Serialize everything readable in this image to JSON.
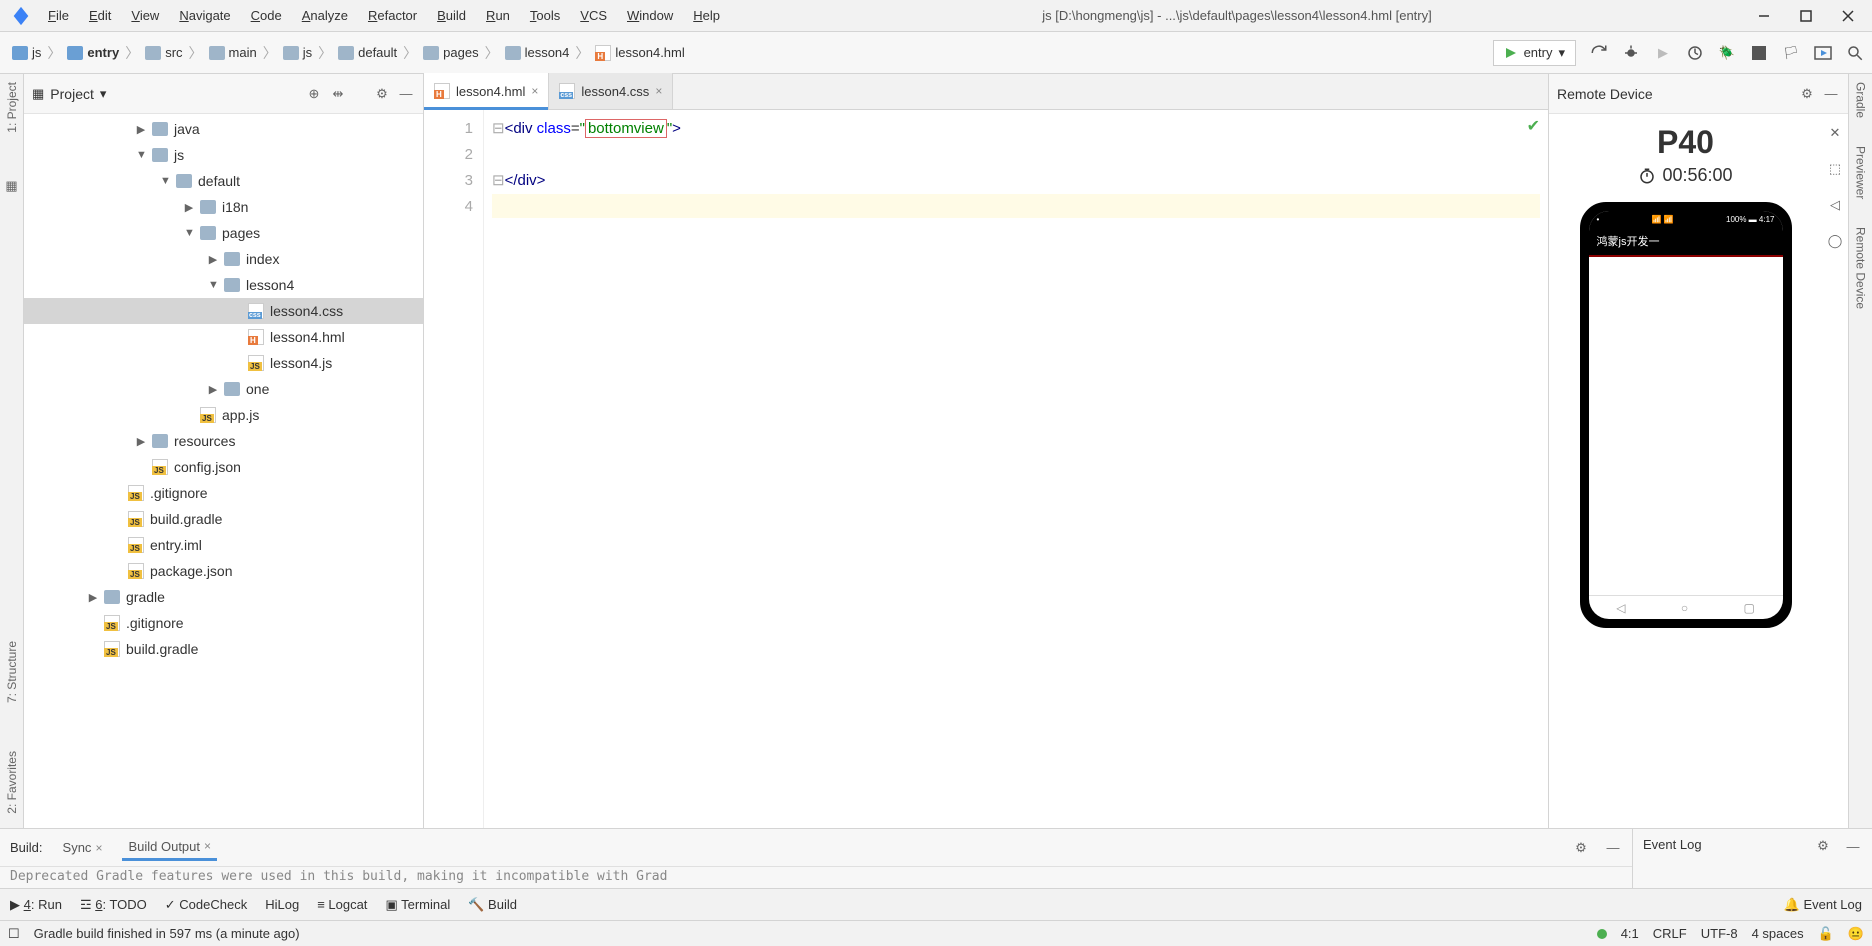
{
  "menubar": {
    "items": [
      "File",
      "Edit",
      "View",
      "Navigate",
      "Code",
      "Analyze",
      "Refactor",
      "Build",
      "Run",
      "Tools",
      "VCS",
      "Window",
      "Help"
    ]
  },
  "window_title": "js [D:\\hongmeng\\js] - ...\\js\\default\\pages\\lesson4\\lesson4.hml [entry]",
  "breadcrumb": [
    "js",
    "entry",
    "src",
    "main",
    "js",
    "default",
    "pages",
    "lesson4",
    "lesson4.hml"
  ],
  "run_config": "entry",
  "left_rail": {
    "project": "1: Project",
    "structure": "7: Structure",
    "favorites": "2: Favorites"
  },
  "right_rail": {
    "gradle": "Gradle",
    "previewer": "Previewer",
    "remote": "Remote Device"
  },
  "project": {
    "title": "Project",
    "tree": [
      {
        "depth": 3,
        "arrow": "▶",
        "icon": "folder",
        "name": "java"
      },
      {
        "depth": 3,
        "arrow": "▼",
        "icon": "folder",
        "name": "js"
      },
      {
        "depth": 4,
        "arrow": "▼",
        "icon": "folder",
        "name": "default"
      },
      {
        "depth": 5,
        "arrow": "▶",
        "icon": "folder",
        "name": "i18n"
      },
      {
        "depth": 5,
        "arrow": "▼",
        "icon": "folder",
        "name": "pages"
      },
      {
        "depth": 6,
        "arrow": "▶",
        "icon": "folder",
        "name": "index"
      },
      {
        "depth": 6,
        "arrow": "▼",
        "icon": "folder",
        "name": "lesson4"
      },
      {
        "depth": 7,
        "arrow": "",
        "icon": "css",
        "name": "lesson4.css",
        "selected": true
      },
      {
        "depth": 7,
        "arrow": "",
        "icon": "hml",
        "name": "lesson4.hml"
      },
      {
        "depth": 7,
        "arrow": "",
        "icon": "js",
        "name": "lesson4.js"
      },
      {
        "depth": 6,
        "arrow": "▶",
        "icon": "folder",
        "name": "one"
      },
      {
        "depth": 5,
        "arrow": "",
        "icon": "js",
        "name": "app.js"
      },
      {
        "depth": 3,
        "arrow": "▶",
        "icon": "folder",
        "name": "resources"
      },
      {
        "depth": 3,
        "arrow": "",
        "icon": "json",
        "name": "config.json"
      },
      {
        "depth": 2,
        "arrow": "",
        "icon": "gi",
        "name": ".gitignore"
      },
      {
        "depth": 2,
        "arrow": "",
        "icon": "gradle",
        "name": "build.gradle"
      },
      {
        "depth": 2,
        "arrow": "",
        "icon": "iml",
        "name": "entry.iml"
      },
      {
        "depth": 2,
        "arrow": "",
        "icon": "json",
        "name": "package.json"
      },
      {
        "depth": 1,
        "arrow": "▶",
        "icon": "folder",
        "name": "gradle"
      },
      {
        "depth": 1,
        "arrow": "",
        "icon": "gi",
        "name": ".gitignore"
      },
      {
        "depth": 1,
        "arrow": "",
        "icon": "gradle",
        "name": "build.gradle"
      }
    ]
  },
  "editor": {
    "tabs": [
      {
        "name": "lesson4.hml",
        "icon": "hml",
        "active": true
      },
      {
        "name": "lesson4.css",
        "icon": "css",
        "active": false
      }
    ],
    "lines": [
      "1",
      "2",
      "3",
      "4"
    ],
    "l1": {
      "open": "<div",
      "attr": " class",
      "eq": "=",
      "q1": "\"",
      "val": "bottomview",
      "q2": "\"",
      "close": ">"
    },
    "l3": "</div>"
  },
  "preview": {
    "title": "Remote Device",
    "device": "P40",
    "time": "00:56:00",
    "status_left": "•",
    "status_sig": "📶 📶",
    "status_right": "100% ▬ 4:17",
    "app_title": "鸿蒙js开发一"
  },
  "bottom": {
    "build_label": "Build:",
    "tabs": [
      "Sync",
      "Build Output"
    ],
    "message": "Deprecated Gradle features were used in this build, making it incompatible with Grad",
    "event_log": "Event Log"
  },
  "toolstrip": {
    "run": "4: Run",
    "todo": "6: TODO",
    "codecheck": "CodeCheck",
    "hilog": "HiLog",
    "logcat": "Logcat",
    "terminal": "Terminal",
    "build": "Build",
    "eventlog": "Event Log"
  },
  "status": {
    "msg": "Gradle build finished in 597 ms (a minute ago)",
    "pos": "4:1",
    "le": "CRLF",
    "enc": "UTF-8",
    "indent": "4 spaces"
  }
}
